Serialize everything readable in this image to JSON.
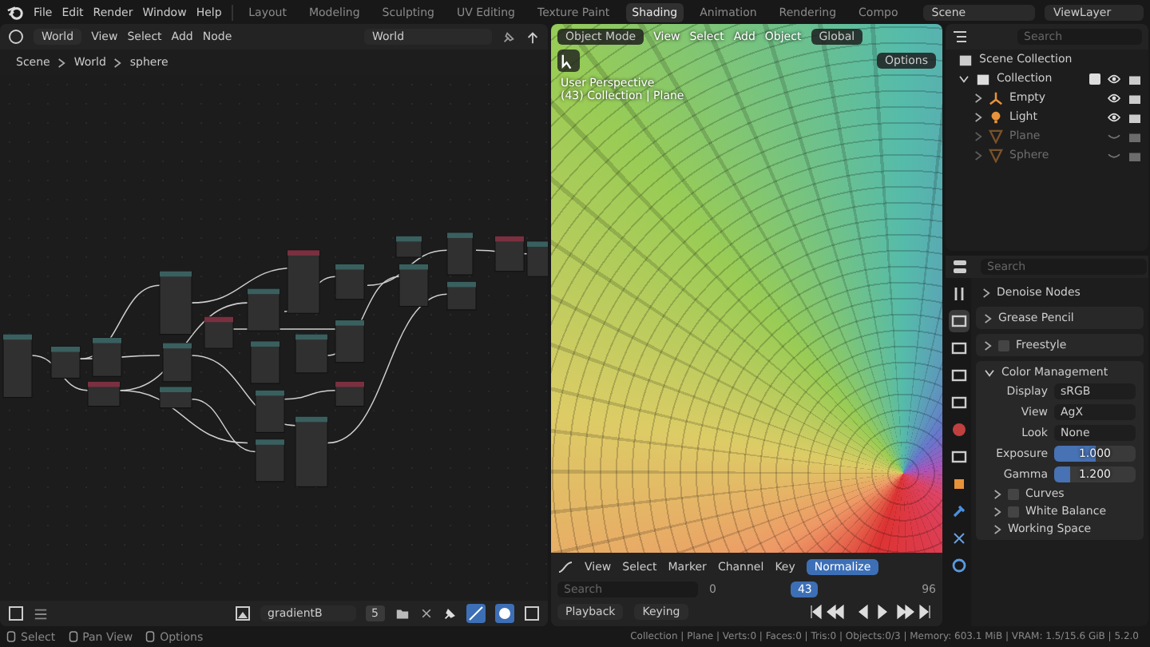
{
  "menu": [
    "File",
    "Edit",
    "Render",
    "Window",
    "Help"
  ],
  "workspaces": [
    {
      "label": "Layout",
      "selected": false
    },
    {
      "label": "Modeling",
      "selected": false
    },
    {
      "label": "Sculpting",
      "selected": false
    },
    {
      "label": "UV Editing",
      "selected": false
    },
    {
      "label": "Texture Paint",
      "selected": false
    },
    {
      "label": "Shading",
      "selected": true
    },
    {
      "label": "Animation",
      "selected": false
    },
    {
      "label": "Rendering",
      "selected": false
    },
    {
      "label": "Compo",
      "selected": false
    }
  ],
  "scene": "Scene",
  "view_layer": "ViewLayer",
  "node_editor": {
    "world": "World",
    "menus": [
      "View",
      "Select",
      "Add",
      "Node"
    ],
    "datablock": "World",
    "breadcrumbs": [
      "Scene",
      "World",
      "sphere"
    ],
    "image": "gradientB",
    "users": "5"
  },
  "viewport": {
    "mode": "Object Mode",
    "menus": [
      "View",
      "Select",
      "Add",
      "Object"
    ],
    "orientation": "Global",
    "options": "Options",
    "overlay": [
      "User Perspective",
      "(43) Collection | Plane"
    ]
  },
  "timeline": {
    "menus": [
      "View",
      "Select",
      "Marker",
      "Channel",
      "Key"
    ],
    "normalize": {
      "label": "Normalize",
      "on": true
    },
    "search_placeholder": "Search",
    "frame_start": "0",
    "current_frame": "43",
    "frame_end": "96",
    "playback": "Playback",
    "keying": "Keying"
  },
  "outliner": {
    "search_placeholder": "Search",
    "scene_collection": "Scene Collection",
    "collection": {
      "name": "Collection",
      "checked": true
    },
    "items": [
      {
        "name": "Empty",
        "kind": "empty",
        "visible": true
      },
      {
        "name": "Light",
        "kind": "light",
        "visible": true
      },
      {
        "name": "Plane",
        "kind": "mesh",
        "visible": false
      },
      {
        "name": "Sphere",
        "kind": "mesh",
        "visible": false
      }
    ]
  },
  "properties": {
    "search_placeholder": "Search",
    "tabs": [
      {
        "kind": "tool",
        "selected": false
      },
      {
        "kind": "render",
        "selected": true
      },
      {
        "kind": "output",
        "selected": false
      },
      {
        "kind": "view_layer",
        "selected": false
      },
      {
        "kind": "scene",
        "selected": false
      },
      {
        "kind": "world",
        "selected": false
      },
      {
        "kind": "collection",
        "selected": false
      },
      {
        "kind": "object",
        "selected": false
      },
      {
        "kind": "modifier",
        "selected": false
      },
      {
        "kind": "particles",
        "selected": false
      },
      {
        "kind": "physics",
        "selected": false
      }
    ],
    "denoise": "Denoise Nodes",
    "grease_pencil": "Grease Pencil",
    "freestyle": {
      "label": "Freestyle",
      "checked": false
    },
    "color_management": "Color Management",
    "fields": [
      {
        "label": "Display",
        "value": "sRGB",
        "kind": "dropdown"
      },
      {
        "label": "View",
        "value": "AgX",
        "kind": "dropdown"
      },
      {
        "label": "Look",
        "value": "None",
        "kind": "dropdown"
      },
      {
        "label": "Exposure",
        "value": "1.000",
        "kind": "slider",
        "level": 0.5
      },
      {
        "label": "Gamma",
        "value": "1.200",
        "kind": "slider",
        "level": 0.2
      }
    ],
    "subpanels": [
      {
        "label": "Curves",
        "checked": false
      },
      {
        "label": "White Balance",
        "checked": false
      }
    ],
    "working_space": "Working Space"
  },
  "status": {
    "hints": [
      "Select",
      "Pan View",
      "Options"
    ],
    "stats": "Collection | Plane | Verts:0 | Faces:0 | Tris:0 | Objects:0/3 | Memory: 603.1 MiB | VRAM: 1.5/15.6 GiB | 5.2.0"
  }
}
